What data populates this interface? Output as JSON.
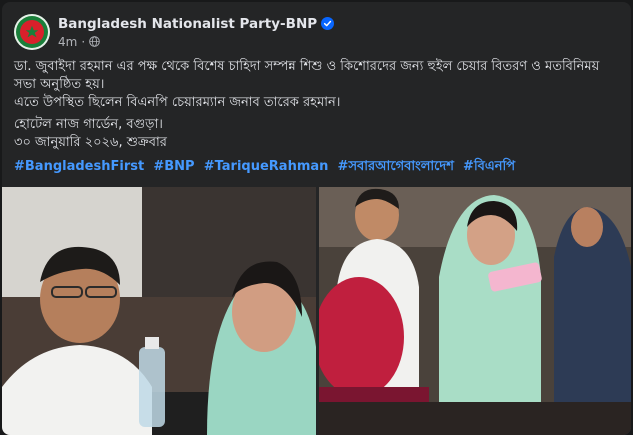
{
  "post": {
    "author": "Bangladesh Nationalist Party-BNP",
    "time": "4m",
    "separator": "·",
    "lines": [
      "ডা. জুবাইদা রহমান এর পক্ষ থেকে বিশেষ চাহিদা সম্পন্ন শিশু ও কিশোরদের জন্য হুইল চেয়ার বিতরণ ও মতবিনিময় সভা অনুষ্ঠিত হয়।",
      "এতে উপস্থিত ছিলেন বিএনপি চেয়ারম্যান জনাব তারেক রহমান।",
      "হোটেল নাজ গার্ডেন, বগুড়া।",
      "৩০ জানুয়ারি ২০২৬, শুক্রবার"
    ],
    "hashtags": [
      "#BangladeshFirst",
      "#BNP",
      "#TariqueRahman",
      "#সবারআগেবাংলাদেশ",
      "#বিএনপি"
    ]
  },
  "icons": {
    "avatar": "bnp-logo",
    "verified": "verified-badge-icon",
    "audience": "globe-icon"
  },
  "colors": {
    "background": "#18191a",
    "card": "#242526",
    "text": "#e4e6eb",
    "muted": "#b0b3b8",
    "link": "#4599ff",
    "verified": "#0866ff"
  }
}
